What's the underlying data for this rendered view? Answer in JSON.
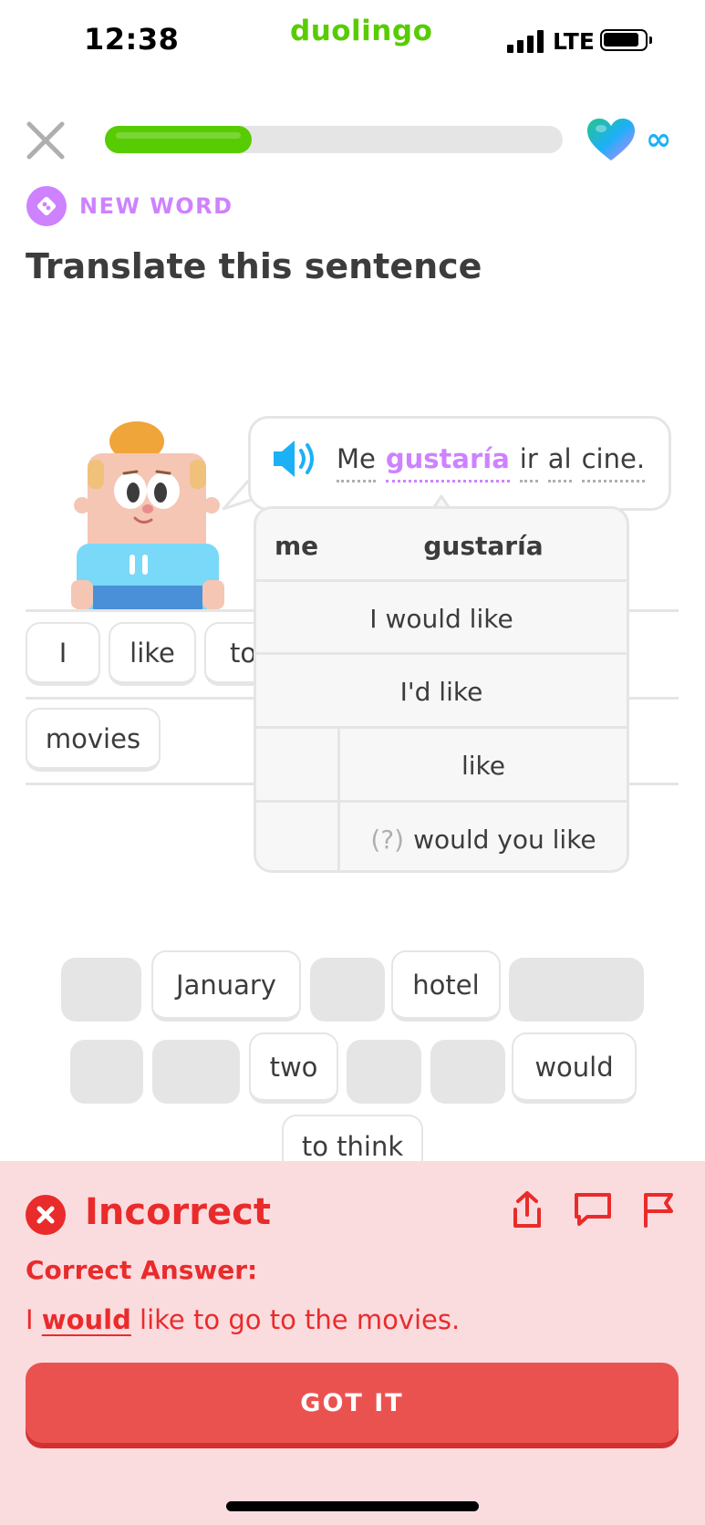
{
  "status_bar": {
    "time": "12:38",
    "brand": "duolingo",
    "network": "LTE"
  },
  "lesson": {
    "progress": 0.32,
    "hearts": "∞",
    "badge_label": "NEW WORD",
    "title": "Translate this sentence"
  },
  "prompt": {
    "words": [
      {
        "text": "Me",
        "highlighted": false
      },
      {
        "text": "gustaría",
        "highlighted": true
      },
      {
        "text": "ir",
        "highlighted": false
      },
      {
        "text": "al",
        "highlighted": false
      },
      {
        "text": "cine.",
        "highlighted": false
      }
    ]
  },
  "answer": {
    "chips": [
      "I",
      "like",
      "to",
      "movies"
    ]
  },
  "hint": {
    "header": [
      "me",
      "gustaría"
    ],
    "rows": [
      {
        "text": "I would like"
      },
      {
        "text": "I'd like"
      },
      {
        "text": "like"
      },
      {
        "prefix": "(?)",
        "text": "would you like"
      }
    ]
  },
  "word_bank": {
    "visible": [
      "January",
      "hotel",
      "two",
      "would",
      "to think"
    ]
  },
  "feedback": {
    "status": "Incorrect",
    "correct_label": "Correct Answer:",
    "answer_before": "I ",
    "answer_highlight": "would",
    "answer_after": " like to go to the movies.",
    "button": "GOT IT"
  },
  "colors": {
    "green": "#58cc02",
    "purple": "#ce82ff",
    "red": "#ea2b2b",
    "panel": "#fadcdf",
    "button": "#ea5250"
  }
}
